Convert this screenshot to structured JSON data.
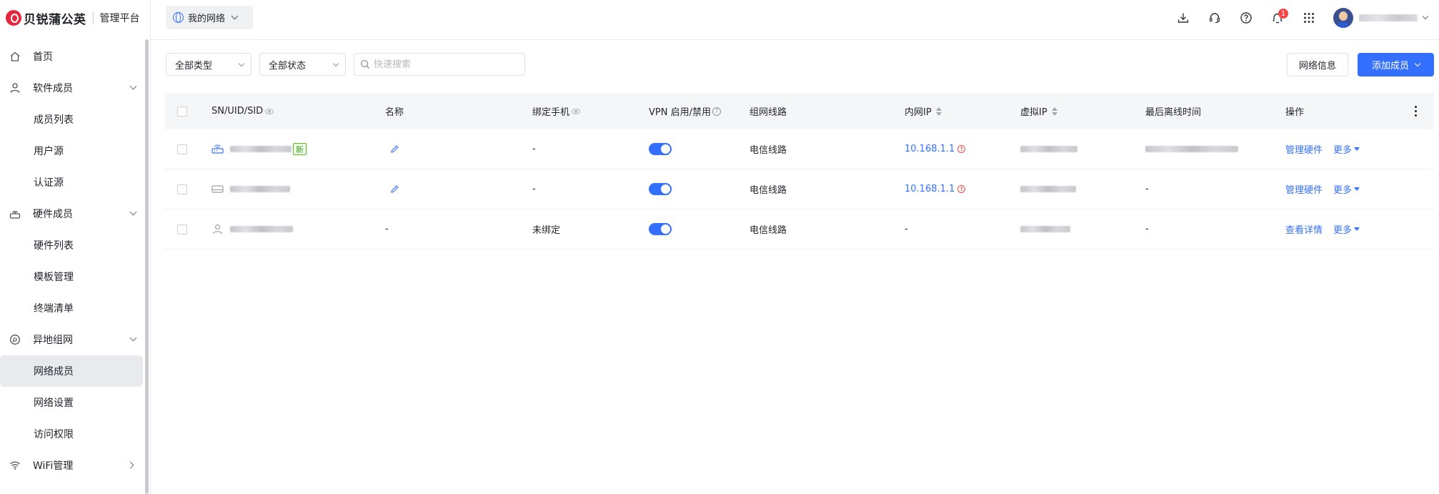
{
  "brand": {
    "name": "贝锐蒲公英",
    "subtitle": "管理平台"
  },
  "network_switch": {
    "label": "我的网络"
  },
  "sidebar": {
    "items": [
      {
        "label": "首页",
        "icon": "home-icon"
      },
      {
        "label": "软件成员",
        "icon": "user-icon",
        "expanded": true
      },
      {
        "label": "成员列表",
        "sub": true
      },
      {
        "label": "用户源",
        "sub": true
      },
      {
        "label": "认证源",
        "sub": true
      },
      {
        "label": "硬件成员",
        "icon": "router-icon",
        "expanded": true
      },
      {
        "label": "硬件列表",
        "sub": true
      },
      {
        "label": "模板管理",
        "sub": true
      },
      {
        "label": "终端清单",
        "sub": true
      },
      {
        "label": "异地组网",
        "icon": "network-icon",
        "expanded": true
      },
      {
        "label": "网络成员",
        "sub": true,
        "active": true
      },
      {
        "label": "网络设置",
        "sub": true
      },
      {
        "label": "访问权限",
        "sub": true
      },
      {
        "label": "WiFi管理",
        "icon": "wifi-icon"
      }
    ]
  },
  "topbar": {
    "icons": [
      "download-icon",
      "headset-icon",
      "help-icon",
      "bell-icon",
      "apps-grid-icon"
    ],
    "notification_count": "1"
  },
  "filters": {
    "type_select": "全部类型",
    "status_select": "全部状态",
    "search_placeholder": "快速搜索"
  },
  "actions": {
    "network_info": "网络信息",
    "add_member": "添加成员"
  },
  "table": {
    "columns": {
      "sn": "SN/UID/SID",
      "name": "名称",
      "phone": "绑定手机",
      "vpn": "VPN 启用/禁用",
      "route": "组网线路",
      "lan_ip": "内网IP",
      "virtual_ip": "虚拟IP",
      "last_offline": "最后离线时间",
      "ops": "操作"
    },
    "rows": [
      {
        "type": "router",
        "is_new": true,
        "new_tag": "新",
        "name": "",
        "phone": "-",
        "vpn_enabled": true,
        "route": "电信线路",
        "lan_ip": "10.168.1.1",
        "lan_warn": true,
        "last_offline": "",
        "action": "管理硬件",
        "more": "更多"
      },
      {
        "type": "device",
        "is_new": false,
        "name": "",
        "phone": "-",
        "vpn_enabled": true,
        "route": "电信线路",
        "lan_ip": "10.168.1.1",
        "lan_warn": true,
        "last_offline": "-",
        "action": "管理硬件",
        "more": "更多"
      },
      {
        "type": "user",
        "is_new": false,
        "name": "-",
        "phone": "未绑定",
        "vpn_enabled": true,
        "route": "电信线路",
        "lan_ip": "-",
        "lan_warn": false,
        "last_offline": "-",
        "action": "查看详情",
        "more": "更多"
      }
    ]
  },
  "colors": {
    "accent": "#3370ff",
    "danger": "#f54a45",
    "new_tag": "#52c41a"
  }
}
